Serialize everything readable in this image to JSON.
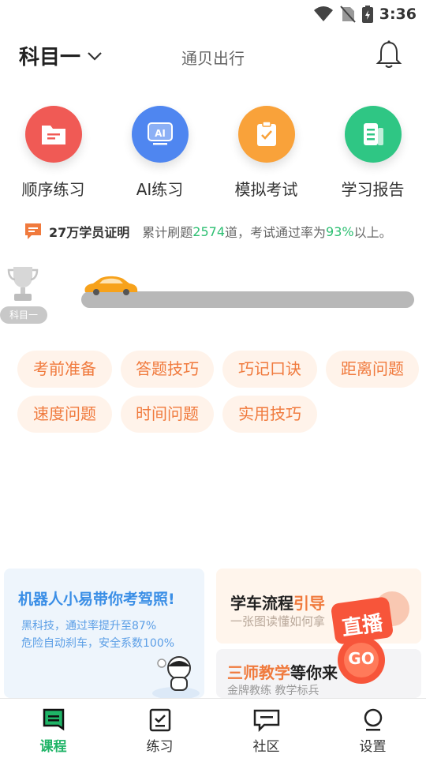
{
  "status_bar": {
    "time": "3:36"
  },
  "header": {
    "subject": "科目一",
    "title": "通贝出行"
  },
  "grid": [
    {
      "label": "顺序练习",
      "color": "#f05a55",
      "icon": "folder-icon"
    },
    {
      "label": "AI练习",
      "color": "#4f86f0",
      "icon": "ai-icon",
      "badge": "AI"
    },
    {
      "label": "模拟考试",
      "color": "#f9a23a",
      "icon": "clipboard-check-icon"
    },
    {
      "label": "学习报告",
      "color": "#2fc684",
      "icon": "report-icon"
    }
  ],
  "proof": {
    "headline": "27万学员证明",
    "text_1": "累计刷题",
    "count": "2574",
    "text_2": "道，考试通过率为",
    "rate": "93%",
    "text_3": "以上。"
  },
  "progress": {
    "subject_tag": "科目一",
    "value": 0
  },
  "tags": [
    "考前准备",
    "答题技巧",
    "巧记口诀",
    "距离问题",
    "速度问题",
    "时间问题",
    "实用技巧"
  ],
  "card_left": {
    "title": "机器人小易带你考驾照!",
    "line1": "黑科技，通过率提升至87%",
    "line2": "危险自动刹车，安全系数100%"
  },
  "card_right_top": {
    "title_a": "学车流程",
    "title_b": "引导",
    "subtitle": "一张图读懂如何拿"
  },
  "card_right_bottom": {
    "title_a": "三师教学",
    "title_b": "等你来",
    "subtitle": "金牌教练 教学标兵"
  },
  "live_badge": {
    "text": "直播",
    "go": "GO"
  },
  "bottom_nav": [
    {
      "label": "课程",
      "icon": "course-icon",
      "active": true
    },
    {
      "label": "练习",
      "icon": "practice-icon",
      "active": false
    },
    {
      "label": "社区",
      "icon": "community-icon",
      "active": false
    },
    {
      "label": "设置",
      "icon": "settings-icon",
      "active": false
    }
  ],
  "colors": {
    "accent_green": "#1fb467",
    "tag_text": "#f07a3d",
    "tag_bg": "#fff3ea"
  }
}
